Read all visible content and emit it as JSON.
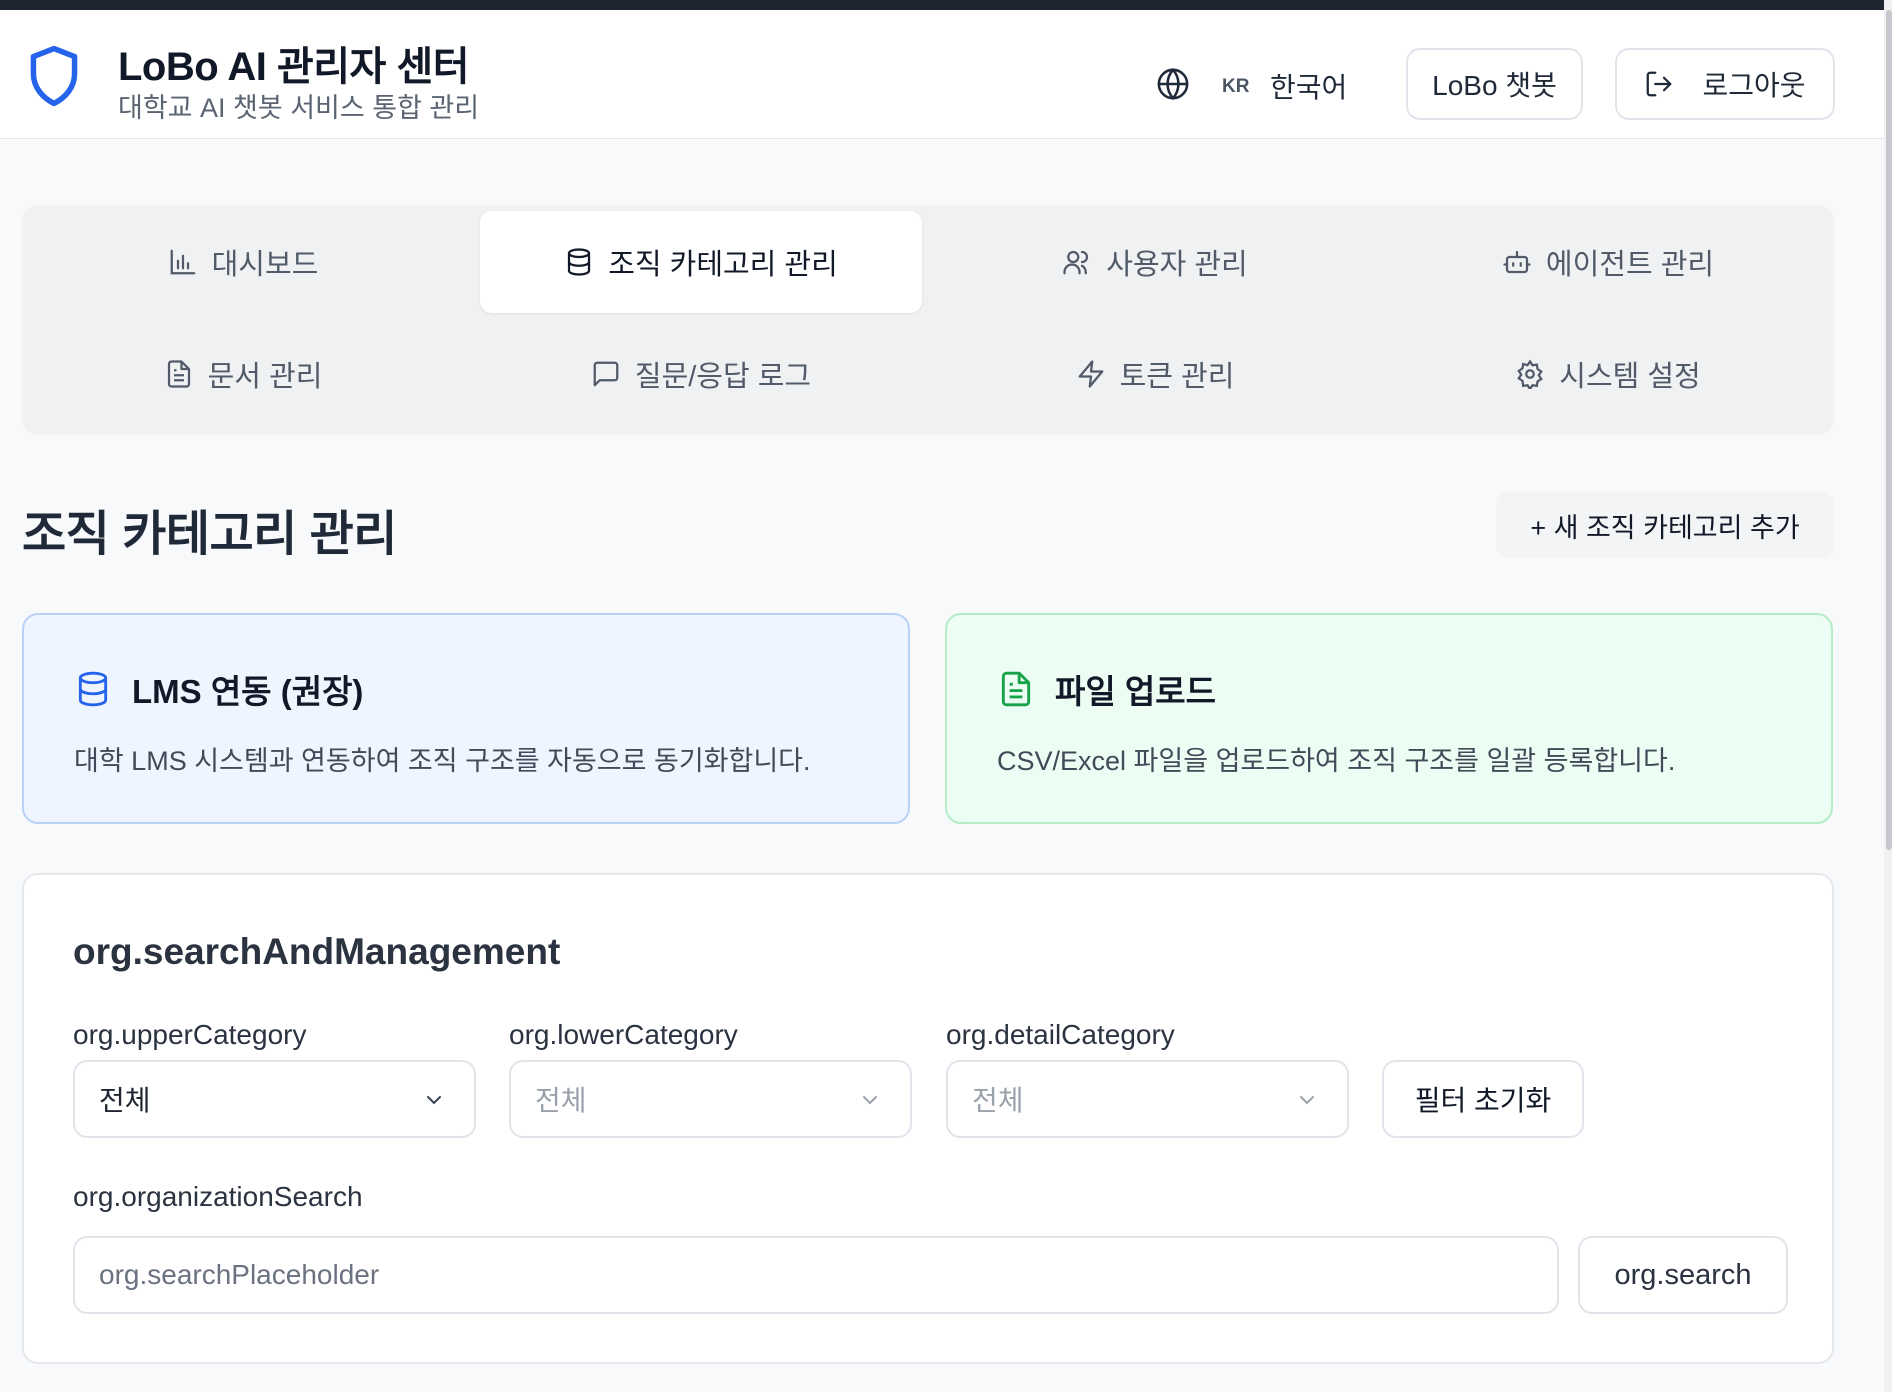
{
  "header": {
    "title": "LoBo AI 관리자 센터",
    "subtitle": "대학교 AI 챗봇 서비스 통합 관리",
    "lang_code": "KR",
    "lang_name": "한국어",
    "chat_button": "LoBo 챗봇",
    "logout_button": "로그아웃"
  },
  "tabs": [
    {
      "label": "대시보드",
      "icon": "bar-chart-icon",
      "active": false
    },
    {
      "label": "조직 카테고리 관리",
      "icon": "database-icon",
      "active": true
    },
    {
      "label": "사용자 관리",
      "icon": "users-icon",
      "active": false
    },
    {
      "label": "에이전트 관리",
      "icon": "bot-icon",
      "active": false
    },
    {
      "label": "문서 관리",
      "icon": "file-text-icon",
      "active": false
    },
    {
      "label": "질문/응답 로그",
      "icon": "message-square-icon",
      "active": false
    },
    {
      "label": "토큰 관리",
      "icon": "zap-icon",
      "active": false
    },
    {
      "label": "시스템 설정",
      "icon": "settings-icon",
      "active": false
    }
  ],
  "page": {
    "title": "조직 카테고리 관리",
    "add_button": "+ 새 조직 카테고리 추가"
  },
  "cards": {
    "lms": {
      "title": "LMS 연동 (권장)",
      "description": "대학 LMS 시스템과 연동하여 조직 구조를 자동으로 동기화합니다."
    },
    "file": {
      "title": "파일 업로드",
      "description": "CSV/Excel 파일을 업로드하여 조직 구조를 일괄 등록합니다."
    }
  },
  "search": {
    "title": "org.searchAndManagement",
    "upper_label": "org.upperCategory",
    "upper_value": "전체",
    "lower_label": "org.lowerCategory",
    "lower_value": "전체",
    "detail_label": "org.detailCategory",
    "detail_value": "전체",
    "reset_button": "필터 초기화",
    "org_search_label": "org.organizationSearch",
    "placeholder": "org.searchPlaceholder",
    "search_button": "org.search"
  },
  "colors": {
    "brand_blue": "#2563eb",
    "green": "#16a34a",
    "dark_strip": "#1f2431"
  }
}
